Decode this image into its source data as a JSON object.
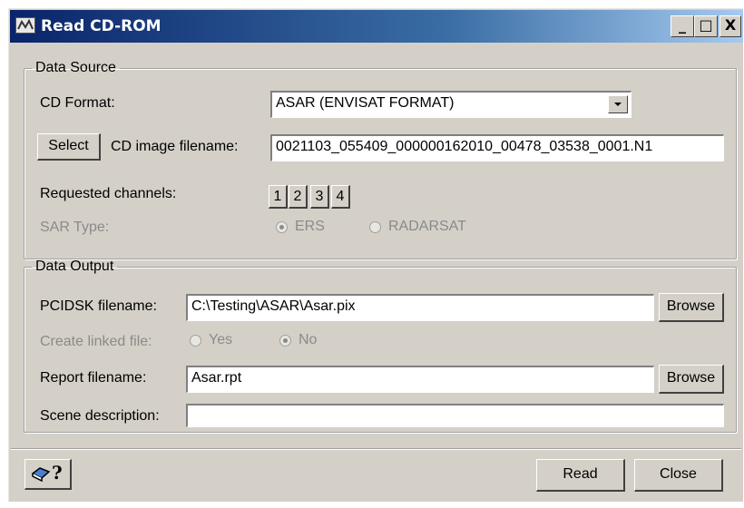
{
  "window": {
    "title": "Read CD-ROM",
    "controls": {
      "minimize": "_",
      "maximize": "□",
      "close": "X"
    }
  },
  "data_source": {
    "legend": "Data Source",
    "cd_format_label": "CD Format:",
    "cd_format_value": "ASAR (ENVISAT FORMAT)",
    "select_button": "Select",
    "cd_image_label": "CD image filename:",
    "cd_image_value": "0021103_055409_000000162010_00478_03538_0001.N1",
    "channels_label": "Requested channels:",
    "channels": [
      "1",
      "2",
      "3",
      "4"
    ],
    "sar_type_label": "SAR Type:",
    "sar_options": [
      "ERS",
      "RADARSAT"
    ],
    "sar_selected": "ERS"
  },
  "data_output": {
    "legend": "Data Output",
    "pcidsk_label": "PCIDSK filename:",
    "pcidsk_value": "C:\\Testing\\ASAR\\Asar.pix",
    "browse_label": "Browse",
    "linked_label": "Create linked file:",
    "linked_options": [
      "Yes",
      "No"
    ],
    "linked_selected": "No",
    "report_label": "Report filename:",
    "report_value": "Asar.rpt",
    "scene_label": "Scene description:",
    "scene_value": ""
  },
  "footer": {
    "help_icon": "help-book-icon",
    "help_text": "?",
    "read_button": "Read",
    "close_button": "Close"
  }
}
